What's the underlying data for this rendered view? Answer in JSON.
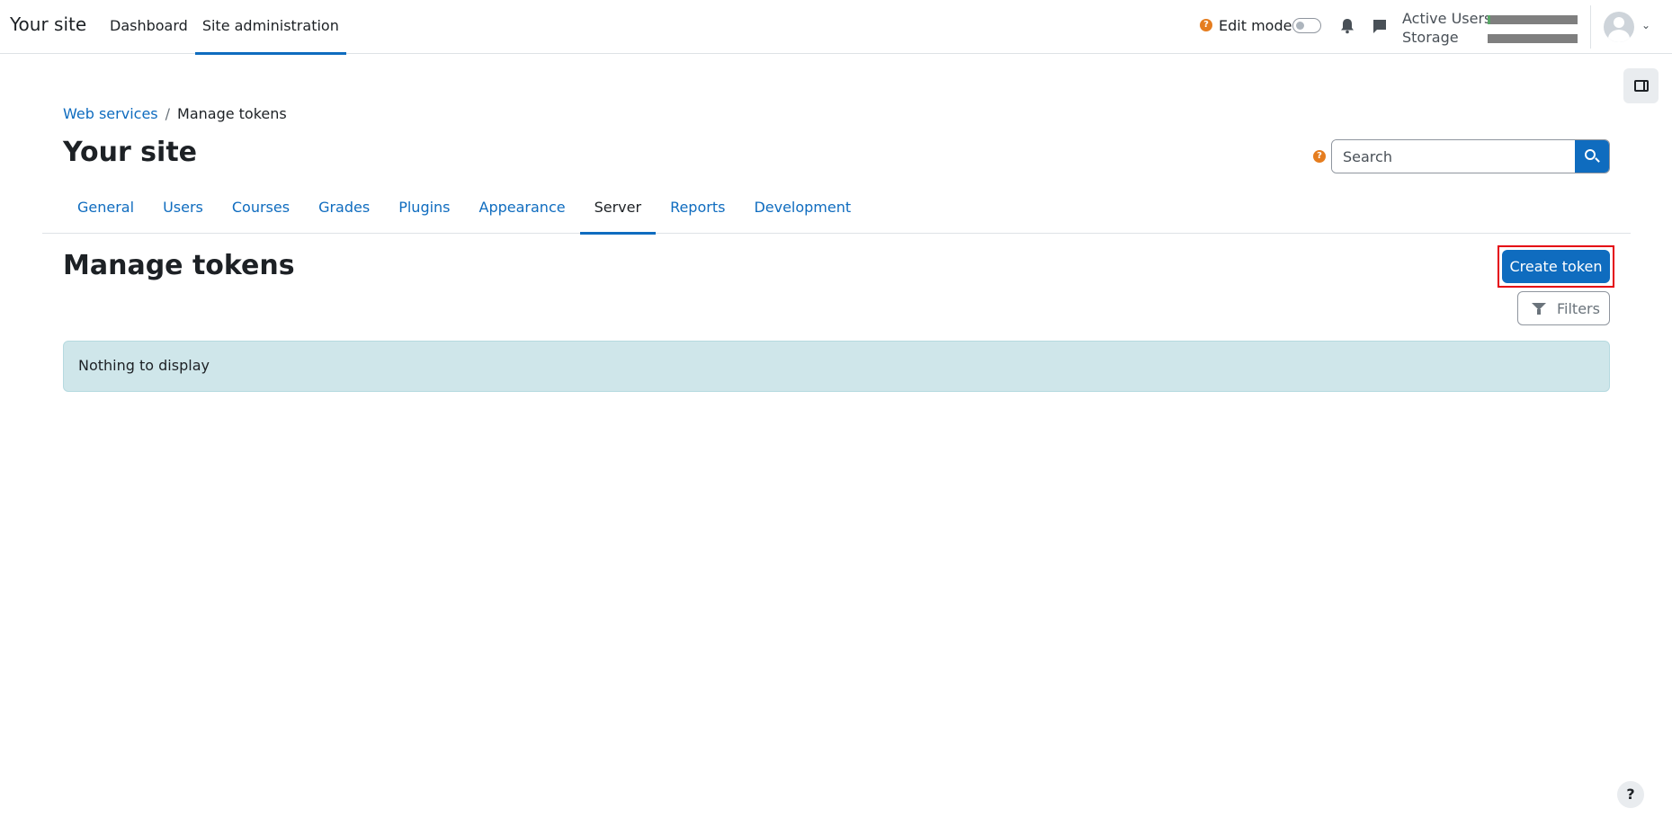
{
  "navbar": {
    "brand": "Your site",
    "primary_nav": [
      {
        "label": "Dashboard",
        "active": false
      },
      {
        "label": "Site administration",
        "active": true
      }
    ],
    "edit_mode_label": "Edit mode",
    "usage": {
      "active_users_label": "Active Users",
      "storage_label": "Storage"
    }
  },
  "breadcrumb": {
    "parent": "Web services",
    "separator": "/",
    "current": "Manage tokens"
  },
  "site_title": "Your site",
  "search": {
    "placeholder": "Search",
    "help_glyph": "?"
  },
  "secondary_nav": [
    {
      "label": "General",
      "active": false
    },
    {
      "label": "Users",
      "active": false
    },
    {
      "label": "Courses",
      "active": false
    },
    {
      "label": "Grades",
      "active": false
    },
    {
      "label": "Plugins",
      "active": false
    },
    {
      "label": "Appearance",
      "active": false
    },
    {
      "label": "Server",
      "active": true
    },
    {
      "label": "Reports",
      "active": false
    },
    {
      "label": "Development",
      "active": false
    }
  ],
  "main": {
    "heading": "Manage tokens",
    "create_button": "Create token",
    "filters_button": "Filters",
    "empty_message": "Nothing to display"
  },
  "help_float": "?",
  "colors": {
    "accent": "#0f6cbf",
    "highlight_border": "#e4000f",
    "alert_bg": "#cfe6ea",
    "help_orange": "#e57d1f"
  }
}
